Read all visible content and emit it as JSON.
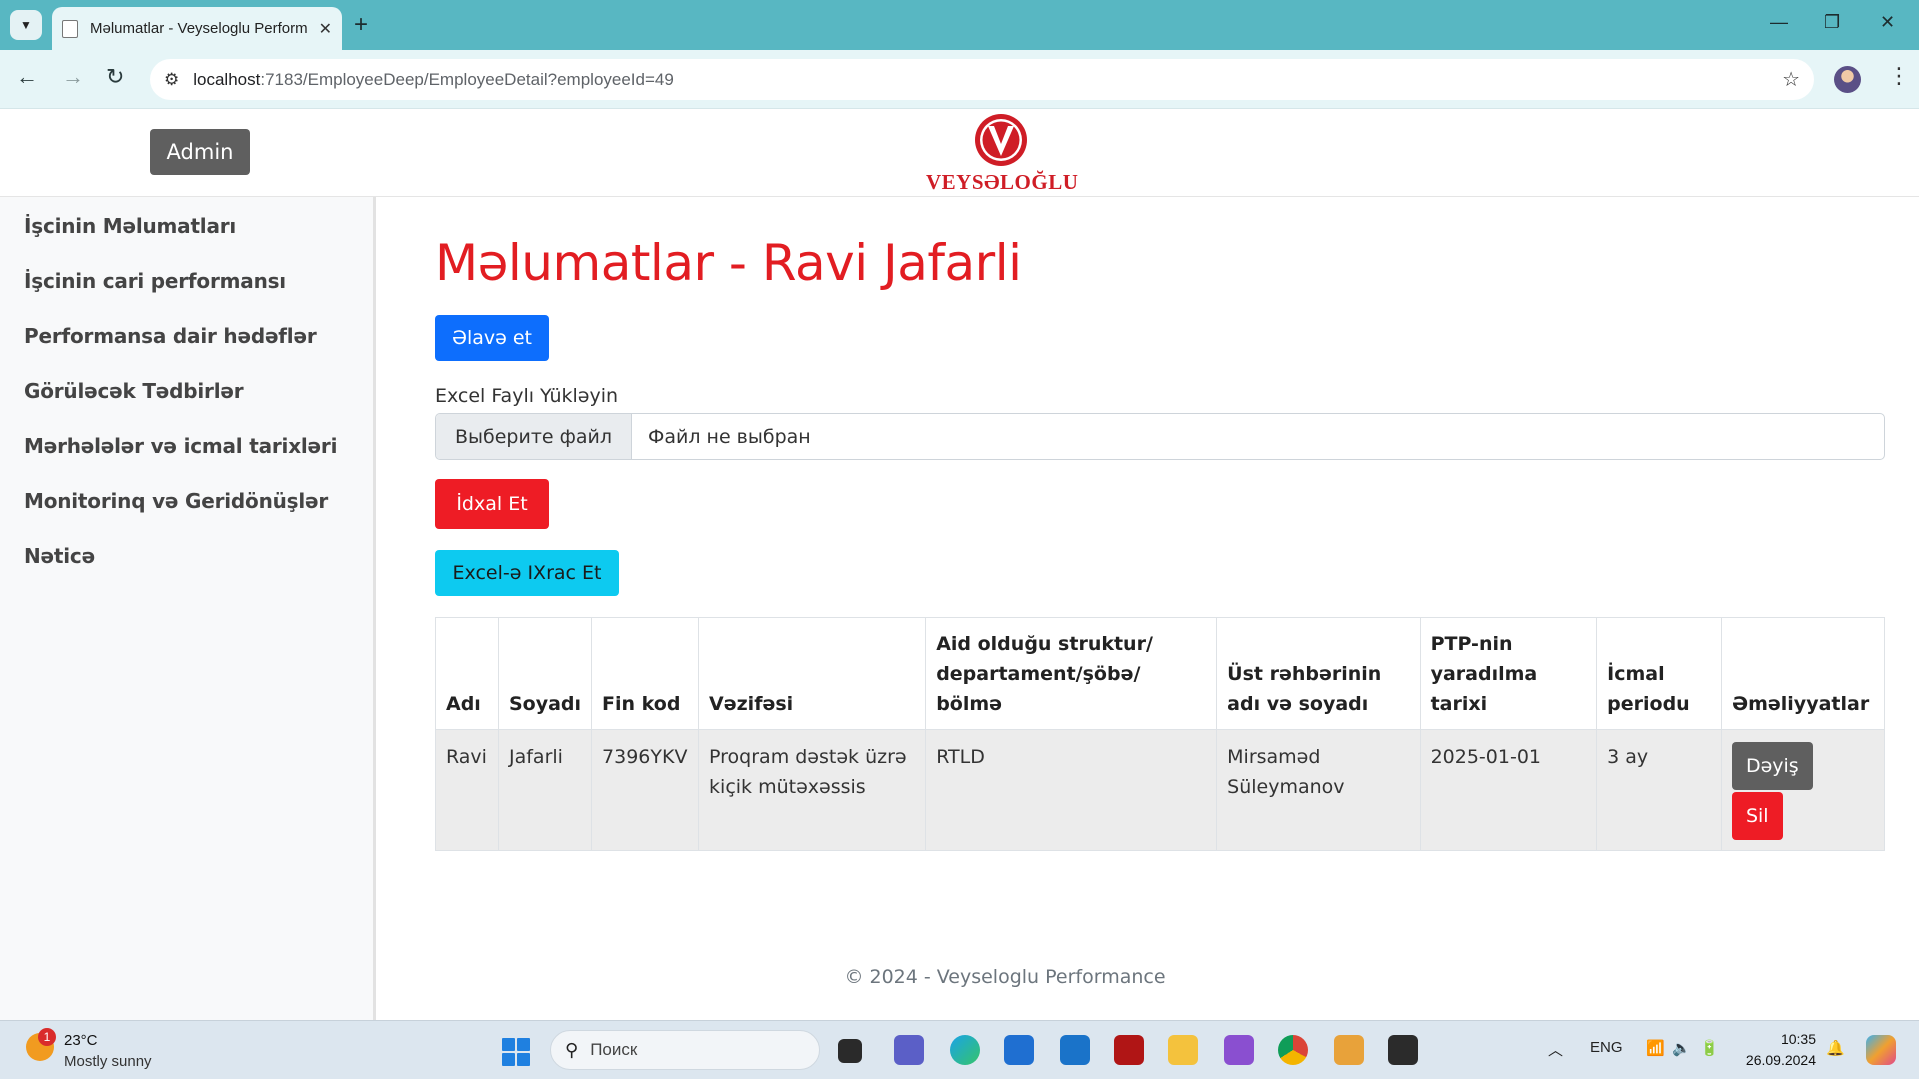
{
  "browser": {
    "tab_title": "Məlumatlar - Veyseloglu Perform",
    "url_host": "localhost",
    "url_path": ":7183/EmployeeDeep/EmployeeDetail?employeeId=49"
  },
  "header": {
    "admin_label": "Admin",
    "logo_text": "VEYSƏLOĞLU"
  },
  "sidebar": {
    "items": [
      {
        "label": "İşcinin Məlumatları"
      },
      {
        "label": "İşcinin cari performansı"
      },
      {
        "label": "Performansa dair hədəflər"
      },
      {
        "label": "Görüləcək Tədbirlər"
      },
      {
        "label": "Mərhələlər və icmal tarixləri"
      },
      {
        "label": "Monitorinq və Geridönüşlər"
      },
      {
        "label": "Nəticə"
      }
    ]
  },
  "main": {
    "title": "Məlumatlar - Ravi Jafarli",
    "add_label": "Əlavə et",
    "upload_label": "Excel Faylı Yükləyin",
    "file_choose_label": "Выберите файл",
    "file_status": "Файл не выбран",
    "import_label": "İdxal Et",
    "export_label": "Excel-ə IXrac Et"
  },
  "table": {
    "headers": [
      "Adı",
      "Soyadı",
      "Fin kod",
      "Vəzifəsi",
      "Aid olduğu struktur/ departament/şöbə/ bölmə",
      "Üst rəhbərinin adı və soyadı",
      "PTP-nin yaradılma tarixi",
      "İcmal periodu",
      "Əməliyyatlar"
    ],
    "row": {
      "name": "Ravi",
      "surname": "Jafarli",
      "fin": "7396YKV",
      "position": "Proqram dəstək üzrə kiçik mütəxəssis",
      "department": "RTLD",
      "manager": "Mirsaməd Süleymanov",
      "created": "2025-01-01",
      "period": "3 ay",
      "edit_label": "Dəyiş",
      "delete_label": "Sil"
    }
  },
  "footer": {
    "text": "© 2024 - Veyseloglu Performance"
  },
  "taskbar": {
    "weather_badge": "1",
    "weather_temp": "23°C",
    "weather_desc": "Mostly sunny",
    "search_placeholder": "Поиск",
    "lang": "ENG",
    "time": "10:35",
    "date": "26.09.2024"
  },
  "colors": {
    "title_red": "#e21d22",
    "primary_blue": "#0d6efd",
    "danger_red": "#ee1c25",
    "info_cyan": "#0dcaf0",
    "secondary_gray": "#5f5f5f",
    "chrome_teal": "#58b7c2"
  }
}
